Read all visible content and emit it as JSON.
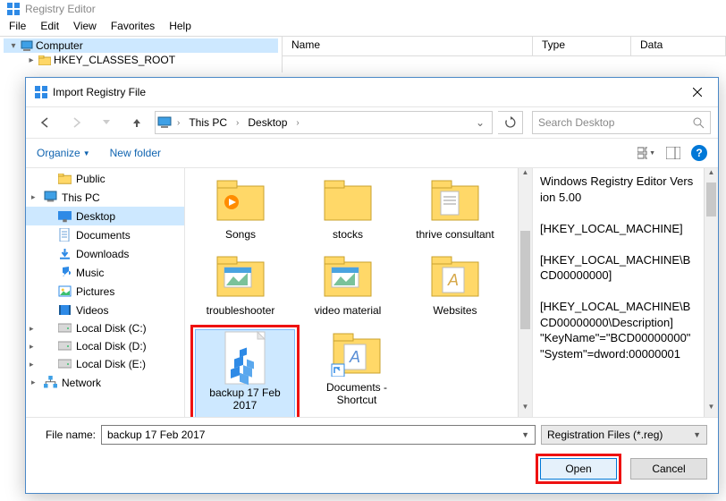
{
  "regedit": {
    "title": "Registry Editor",
    "menu": [
      "File",
      "Edit",
      "View",
      "Favorites",
      "Help"
    ],
    "tree": {
      "root": "Computer",
      "child": "HKEY_CLASSES_ROOT"
    },
    "columns": [
      "Name",
      "Type",
      "Data"
    ]
  },
  "dialog": {
    "title": "Import Registry File",
    "breadcrumb": [
      "This PC",
      "Desktop"
    ],
    "search_placeholder": "Search Desktop",
    "toolbar": {
      "organize": "Organize",
      "new_folder": "New folder"
    },
    "nav_tree": [
      {
        "label": "Public",
        "level": 2,
        "icon": "folder"
      },
      {
        "label": "This PC",
        "level": 1,
        "icon": "pc",
        "expandable": true
      },
      {
        "label": "Desktop",
        "level": 2,
        "icon": "desktop",
        "selected": true
      },
      {
        "label": "Documents",
        "level": 2,
        "icon": "documents"
      },
      {
        "label": "Downloads",
        "level": 2,
        "icon": "downloads"
      },
      {
        "label": "Music",
        "level": 2,
        "icon": "music"
      },
      {
        "label": "Pictures",
        "level": 2,
        "icon": "pictures"
      },
      {
        "label": "Videos",
        "level": 2,
        "icon": "videos"
      },
      {
        "label": "Local Disk (C:)",
        "level": 2,
        "icon": "disk",
        "expandable": true
      },
      {
        "label": "Local Disk (D:)",
        "level": 2,
        "icon": "disk",
        "expandable": true
      },
      {
        "label": "Local Disk (E:)",
        "level": 2,
        "icon": "disk",
        "expandable": true
      },
      {
        "label": "Network",
        "level": 1,
        "icon": "network",
        "expandable": true
      }
    ],
    "files": [
      {
        "label": "Songs",
        "icon": "folder-media"
      },
      {
        "label": "stocks",
        "icon": "folder"
      },
      {
        "label": "thrive consultant",
        "icon": "folder-docs"
      },
      {
        "label": "troubleshooter",
        "icon": "folder-pics"
      },
      {
        "label": "video material",
        "icon": "folder-pics"
      },
      {
        "label": "Websites",
        "icon": "folder-font"
      },
      {
        "label": "backup 17 Feb 2017",
        "icon": "regfile",
        "selected": true,
        "highlighted": true
      },
      {
        "label": "Documents - Shortcut",
        "icon": "folder-shortcut"
      }
    ],
    "preview_lines": [
      "Windows Registry Editor Version 5.00",
      "",
      "[HKEY_LOCAL_MACHINE]",
      "",
      "[HKEY_LOCAL_MACHINE\\BCD00000000]",
      "",
      "[HKEY_LOCAL_MACHINE\\BCD00000000\\Description]",
      "\"KeyName\"=\"BCD00000000\"",
      "\"System\"=dword:00000001"
    ],
    "file_name_label": "File name:",
    "file_name_value": "backup 17 Feb 2017",
    "file_type_value": "Registration Files (*.reg)",
    "open_label": "Open",
    "cancel_label": "Cancel"
  }
}
